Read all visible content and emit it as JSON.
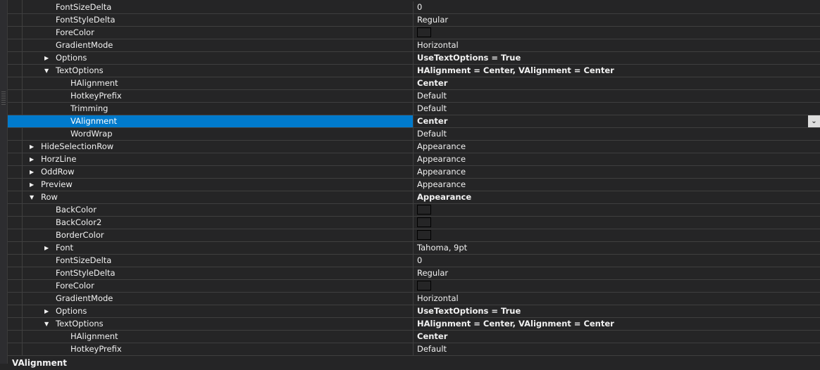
{
  "rows": [
    {
      "name": "FontSizeDelta",
      "value": "0",
      "level": 1
    },
    {
      "name": "FontStyleDelta",
      "value": "Regular",
      "level": 1
    },
    {
      "name": "ForeColor",
      "value": "",
      "swatch": true,
      "level": 1
    },
    {
      "name": "GradientMode",
      "value": "Horizontal",
      "level": 1
    },
    {
      "name": "Options",
      "value": "UseTextOptions = True",
      "bold": true,
      "level": 1,
      "expander": "collapsed"
    },
    {
      "name": "TextOptions",
      "value": "HAlignment = Center, VAlignment = Center",
      "bold": true,
      "level": 1,
      "expander": "expanded"
    },
    {
      "name": "HAlignment",
      "value": "Center",
      "bold": true,
      "level": 2
    },
    {
      "name": "HotkeyPrefix",
      "value": "Default",
      "level": 2
    },
    {
      "name": "Trimming",
      "value": "Default",
      "level": 2
    },
    {
      "name": "VAlignment",
      "value": "Center",
      "bold": true,
      "level": 2,
      "selected": true,
      "dropdown": true
    },
    {
      "name": "WordWrap",
      "value": "Default",
      "level": 2
    },
    {
      "name": "HideSelectionRow",
      "value": "Appearance",
      "level": 0,
      "expander": "collapsed"
    },
    {
      "name": "HorzLine",
      "value": "Appearance",
      "level": 0,
      "expander": "collapsed"
    },
    {
      "name": "OddRow",
      "value": "Appearance",
      "level": 0,
      "expander": "collapsed"
    },
    {
      "name": "Preview",
      "value": "Appearance",
      "level": 0,
      "expander": "collapsed"
    },
    {
      "name": "Row",
      "value": "Appearance",
      "bold": true,
      "level": 0,
      "expander": "expanded"
    },
    {
      "name": "BackColor",
      "value": "",
      "swatch": true,
      "level": 1
    },
    {
      "name": "BackColor2",
      "value": "",
      "swatch": true,
      "level": 1
    },
    {
      "name": "BorderColor",
      "value": "",
      "swatch": true,
      "level": 1
    },
    {
      "name": "Font",
      "value": "Tahoma, 9pt",
      "level": 1,
      "expander": "collapsed"
    },
    {
      "name": "FontSizeDelta",
      "value": "0",
      "level": 1
    },
    {
      "name": "FontStyleDelta",
      "value": "Regular",
      "level": 1
    },
    {
      "name": "ForeColor",
      "value": "",
      "swatch": true,
      "level": 1
    },
    {
      "name": "GradientMode",
      "value": "Horizontal",
      "level": 1
    },
    {
      "name": "Options",
      "value": "UseTextOptions = True",
      "bold": true,
      "level": 1,
      "expander": "collapsed"
    },
    {
      "name": "TextOptions",
      "value": "HAlignment = Center, VAlignment = Center",
      "bold": true,
      "level": 1,
      "expander": "expanded"
    },
    {
      "name": "HAlignment",
      "value": "Center",
      "bold": true,
      "level": 2
    },
    {
      "name": "HotkeyPrefix",
      "value": "Default",
      "level": 2
    }
  ],
  "description": {
    "title": "VAlignment"
  },
  "colors": {
    "selection": "#007acc",
    "background": "#252526",
    "gridline": "#3f3f3f"
  }
}
